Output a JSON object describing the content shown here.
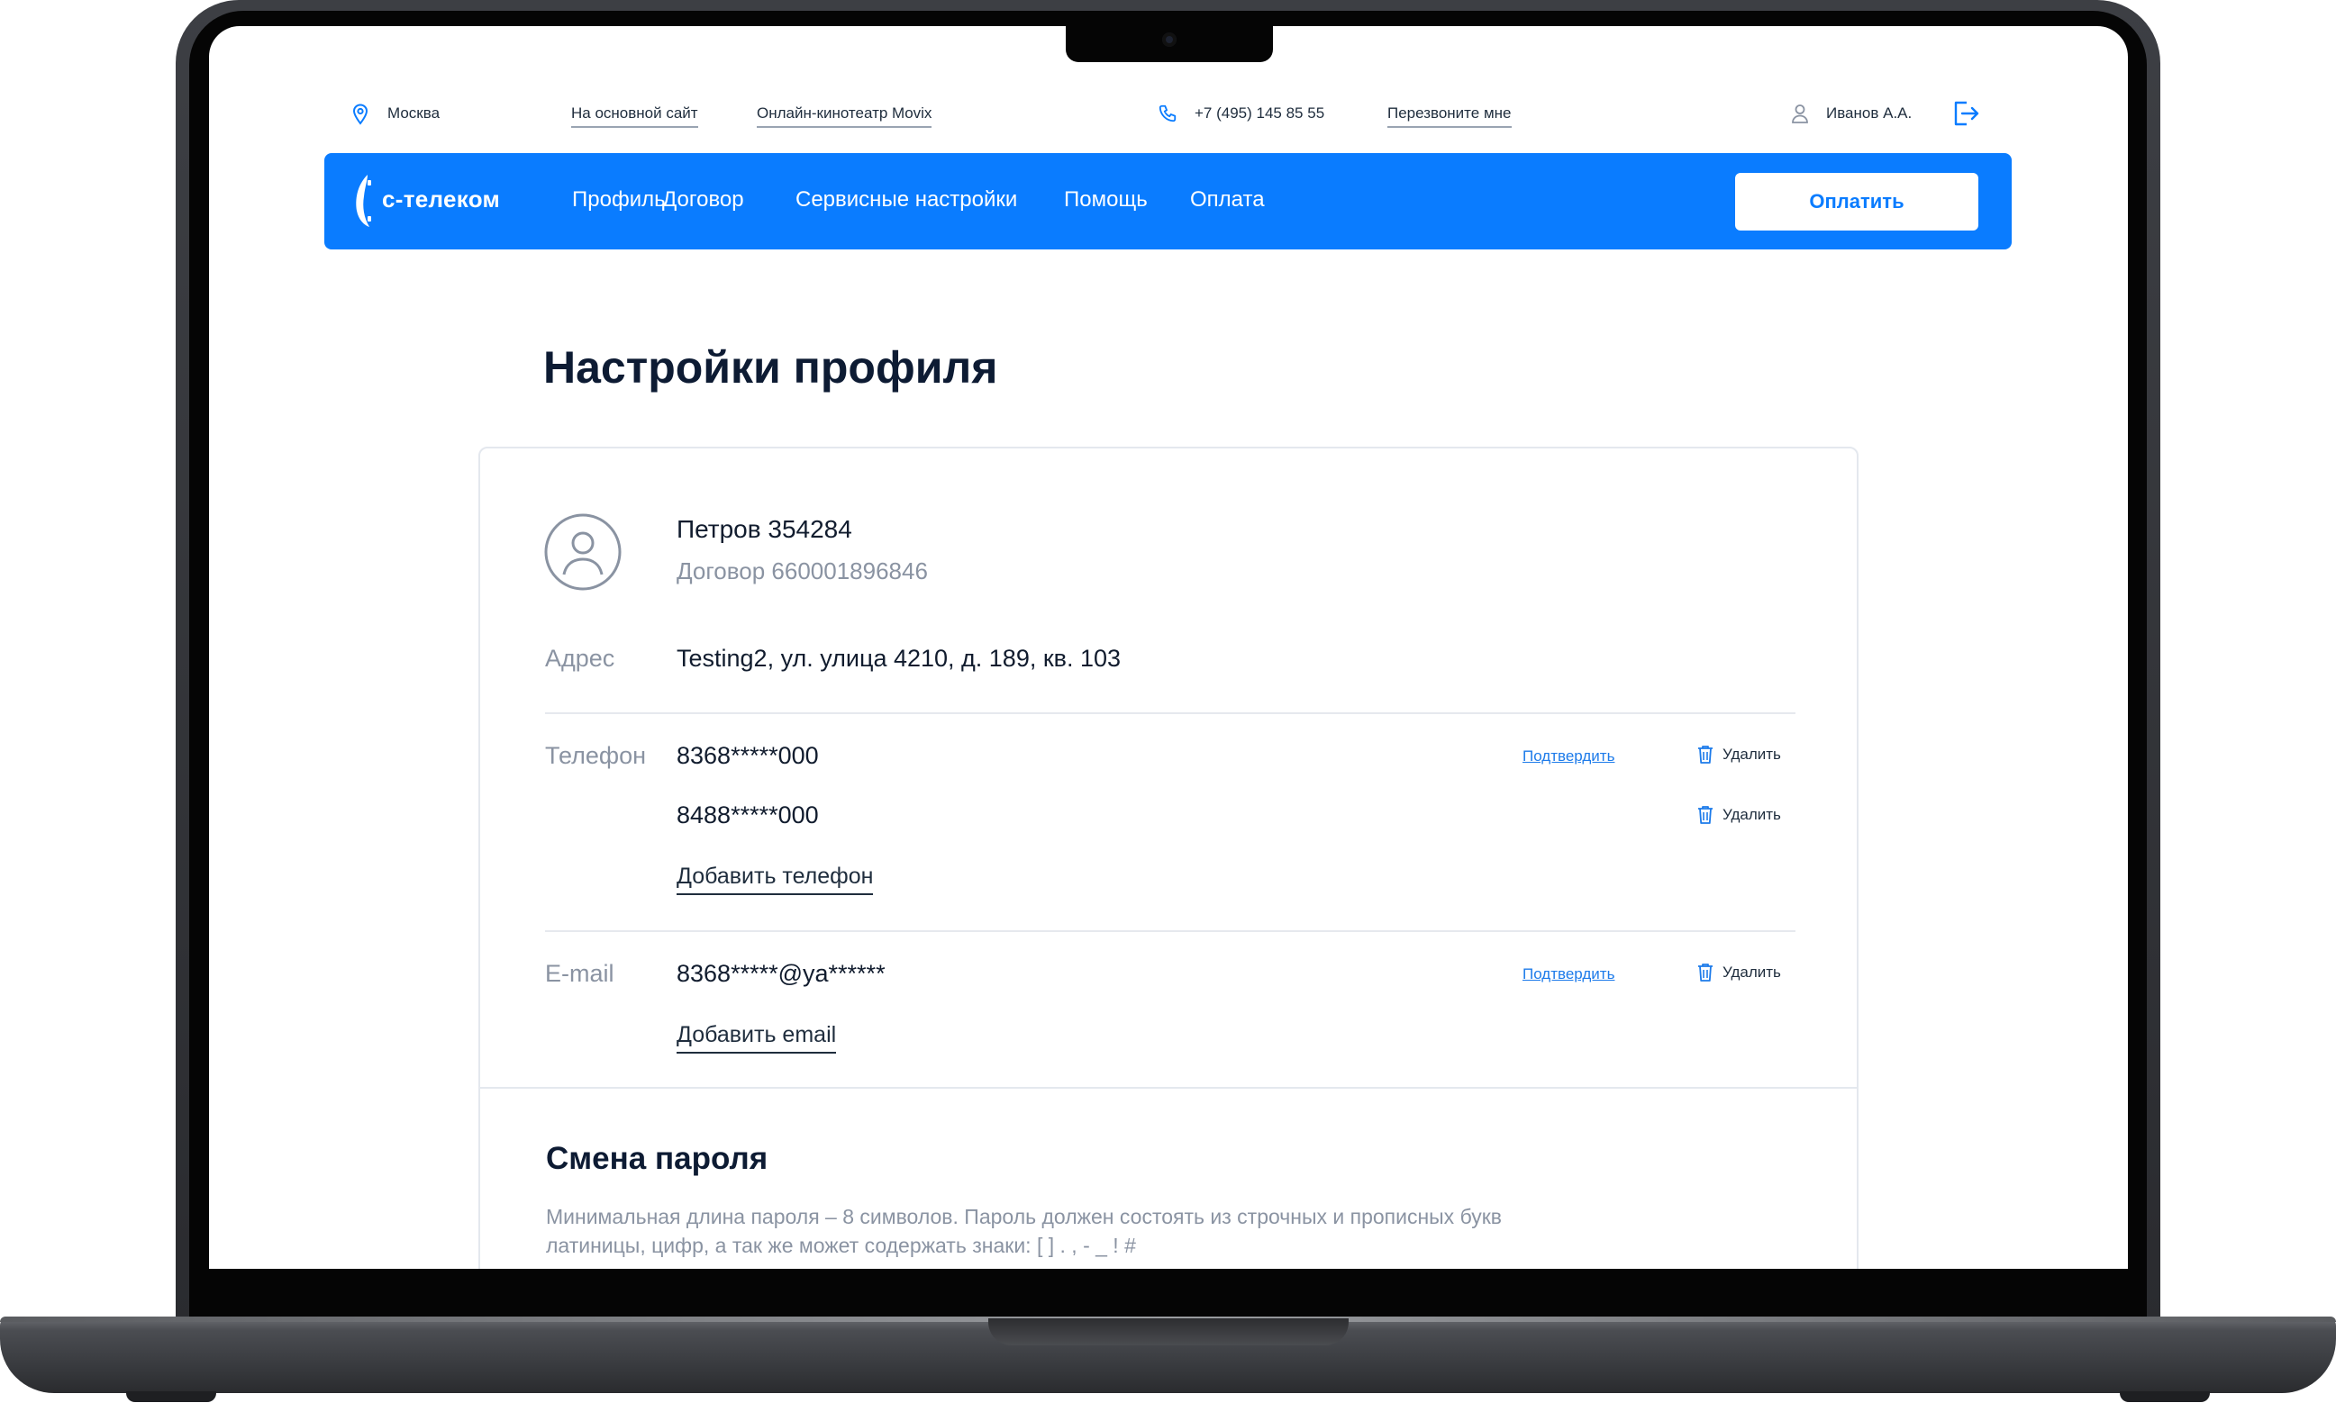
{
  "topbar": {
    "city": "Москва",
    "main_site_link": "На основной сайт",
    "cinema_link": "Онлайн-кинотеатр Movix",
    "phone": "+7 (495) 145 85 55",
    "callback_link": "Перезвоните мне",
    "user_name": "Иванов А.А."
  },
  "navbar": {
    "logo_text": "с-телеком",
    "items": [
      "Профиль",
      "Договор",
      "Сервисные настройки",
      "Помощь",
      "Оплата"
    ],
    "pay_button": "Оплатить"
  },
  "page": {
    "title": "Настройки профиля"
  },
  "profile": {
    "name": "Петров 354284",
    "contract": "Договор 660001896846",
    "address_label": "Адрес",
    "address_value": "Testing2, ул. улица 4210, д. 189, кв. 103",
    "phone_label": "Телефон",
    "phones": [
      {
        "value": "8368*****000",
        "confirm": "Подтвердить",
        "delete": "Удалить"
      },
      {
        "value": "8488*****000",
        "delete": "Удалить"
      }
    ],
    "add_phone": "Добавить телефон",
    "email_label": "E-mail",
    "emails": [
      {
        "value": "8368*****@ya******",
        "confirm": "Подтвердить",
        "delete": "Удалить"
      }
    ],
    "add_email": "Добавить email"
  },
  "password": {
    "title": "Смена пароля",
    "description": "Минимальная длина пароля – 8 символов. Пароль должен состоять из строчных и прописных букв латиницы, цифр, а так же может содержать знаки: [ ] . , - _ ! #"
  },
  "colors": {
    "brand_blue": "#0a7cff",
    "link_blue": "#1d7bea",
    "text_dark": "#111c2e",
    "text_muted": "#8a93a2"
  },
  "icons": {
    "location": "location-pin-icon",
    "phone": "phone-icon",
    "user": "user-icon",
    "logout": "logout-icon",
    "avatar": "avatar-icon",
    "trash": "trash-icon"
  }
}
